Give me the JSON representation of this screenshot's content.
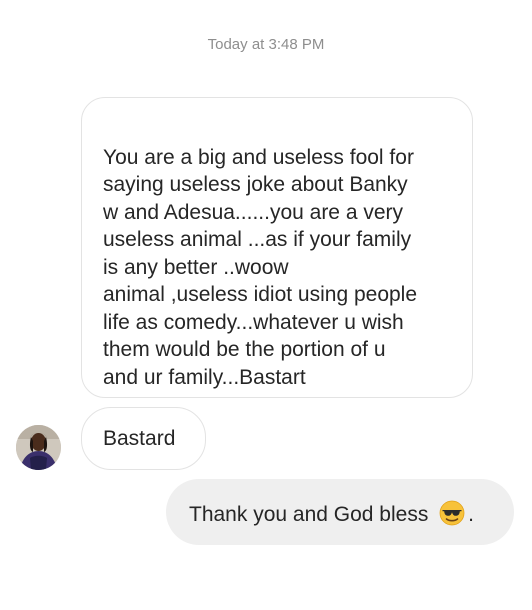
{
  "timestamp": "Today at 3:48 PM",
  "messages": [
    {
      "sender": "them",
      "text": "You are a big and useless fool for\nsaying useless joke about Banky\nw and Adesua......you are a very\nuseless animal ...as if your family\nis any better ..woow\nanimal ,useless idiot using people\nlife as comedy...whatever u wish\nthem would be the portion of u\nand ur family...Bastart"
    },
    {
      "sender": "them",
      "text": "Bastard"
    },
    {
      "sender": "me",
      "text": "Thank you and God bless",
      "emoji": "smiling-face-with-sunglasses-emoji",
      "trailing": "."
    }
  ],
  "colors": {
    "timestamp": "#8e8e8e",
    "incoming_border": "#e3e3e3",
    "outgoing_bg": "#efefef",
    "text": "#262626"
  }
}
